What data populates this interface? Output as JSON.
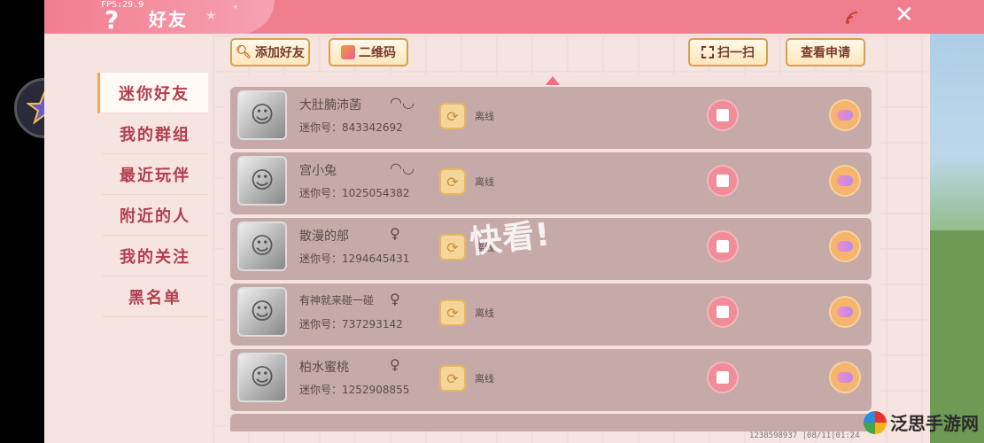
{
  "topbar": {
    "fps": "FPS:29.9",
    "help_icon": "?",
    "title": "好友",
    "close_icon": "✕"
  },
  "sidebar": {
    "items": [
      {
        "label": "迷你好友",
        "active": true
      },
      {
        "label": "我的群组"
      },
      {
        "label": "最近玩伴"
      },
      {
        "label": "附近的人"
      },
      {
        "label": "我的关注"
      },
      {
        "label": "黑名单"
      }
    ]
  },
  "toolbar": {
    "add_friend": "添加好友",
    "qr_code": "二维码",
    "scan": "扫一扫",
    "view_requests": "查看申请"
  },
  "friends": [
    {
      "name": "大肚腩沛菡",
      "id_label": "迷你号：",
      "id": "843342692",
      "gender_icon": "mask-icon",
      "gender_glyph": "◠◡",
      "status": "离线"
    },
    {
      "name": "宫小兔",
      "id_label": "迷你号：",
      "id": "1025054382",
      "gender_icon": "mask-icon",
      "gender_glyph": "◠◡",
      "status": "离线"
    },
    {
      "name": "散漫的郍",
      "id_label": "迷你号：",
      "id": "1294645431",
      "gender_icon": "female-icon",
      "gender_glyph": "♀",
      "status": "离线"
    },
    {
      "name": "有神就来碰一碰",
      "id_label": "迷你号：",
      "id": "737293142",
      "gender_icon": "female-icon",
      "gender_glyph": "♀",
      "status": "离线"
    },
    {
      "name": "柏水蜜桃",
      "id_label": "迷你号：",
      "id": "1252908855",
      "gender_icon": "female-icon",
      "gender_glyph": "♀",
      "status": "离线"
    }
  ],
  "watermark": "快看!",
  "footer": "1238598937  |08/11|01:24",
  "logo_text": "泛思手游网",
  "colors": {
    "accent": "#f07e8e",
    "sidebar_text": "#b23e4e",
    "row_bg": "#c6aaa7"
  }
}
